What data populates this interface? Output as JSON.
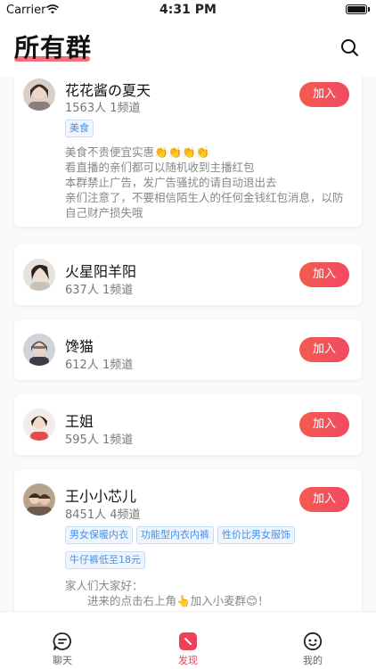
{
  "status_bar": {
    "carrier": "Carrier",
    "time": "4:31 PM"
  },
  "header": {
    "title": "所有群"
  },
  "colors": {
    "accent": "#F24A62",
    "tag_text": "#4A90E2"
  },
  "groups": [
    {
      "name": "花花酱の夏天",
      "stats": "1563人 1频道",
      "join_label": "加入",
      "tags": [
        "美食"
      ],
      "description": [
        "美食不贵便宜实惠👏👏👏👏",
        "看直播的亲们都可以随机收到主播红包",
        "本群禁止广告，发广告骚扰的请自动退出去",
        "亲们注意了，不要相信陌生人的任何金钱红包消息，以防自己财产损失哦"
      ]
    },
    {
      "name": "火星阳羊阳",
      "stats": "637人 1频道",
      "join_label": "加入"
    },
    {
      "name": "馋猫",
      "stats": "612人 1频道",
      "join_label": "加入"
    },
    {
      "name": "王姐",
      "stats": "595人 1频道",
      "join_label": "加入"
    },
    {
      "name": "王小小芯儿",
      "stats": "8451人 4频道",
      "join_label": "加入",
      "tags": [
        "男女保暖内衣",
        "功能型内衣内裤",
        "性价比男女服饰",
        "牛仔裤低至18元"
      ],
      "description": [
        "家人们大家好：",
        "　　进来的点击右上角👆加入小麦群😊！"
      ]
    }
  ],
  "tabbar": {
    "items": [
      {
        "label": "聊天",
        "icon": "chat-icon",
        "active": false
      },
      {
        "label": "发现",
        "icon": "discover-icon",
        "active": true
      },
      {
        "label": "我的",
        "icon": "profile-icon",
        "active": false
      }
    ]
  }
}
